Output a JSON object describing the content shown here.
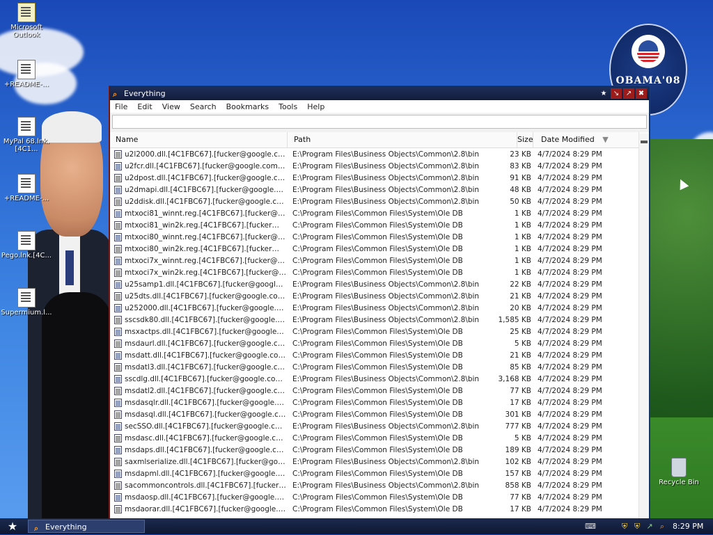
{
  "desktop": {
    "icons": [
      {
        "label": "Microsoft Outlook",
        "icon": "outlook-icon"
      },
      {
        "label": "+README-...",
        "icon": "document-icon"
      },
      {
        "label": "MyPal 68.lnk.[4C1...",
        "icon": "shortcut-icon"
      },
      {
        "label": "+README-...",
        "icon": "document-icon"
      },
      {
        "label": "Pego.lnk.[4C...",
        "icon": "shortcut-icon"
      },
      {
        "label": "Supermium.l...",
        "icon": "shortcut-icon"
      }
    ],
    "recycle_bin": "Recycle Bin",
    "wallpaper_badge": "OBAMA'08"
  },
  "window": {
    "title": "Everything",
    "menu": [
      "File",
      "Edit",
      "View",
      "Search",
      "Bookmarks",
      "Tools",
      "Help"
    ],
    "search": {
      "value": "",
      "placeholder": ""
    },
    "columns": {
      "name": "Name",
      "path": "Path",
      "size": "Size",
      "date": "Date Modified"
    },
    "rows": [
      {
        "name": "u2l2000.dll.[4C1FBC67].[fucker@google.com...",
        "path": "E:\\Program Files\\Business Objects\\Common\\2.8\\bin",
        "size": "23 KB",
        "date": "4/7/2024 8:29 PM"
      },
      {
        "name": "u2fcr.dll.[4C1FBC67].[fucker@google.com].f...",
        "path": "E:\\Program Files\\Business Objects\\Common\\2.8\\bin",
        "size": "83 KB",
        "date": "4/7/2024 8:29 PM"
      },
      {
        "name": "u2dpost.dll.[4C1FBC67].[fucker@google.com...",
        "path": "E:\\Program Files\\Business Objects\\Common\\2.8\\bin",
        "size": "91 KB",
        "date": "4/7/2024 8:29 PM"
      },
      {
        "name": "u2dmapi.dll.[4C1FBC67].[fucker@google.com...",
        "path": "E:\\Program Files\\Business Objects\\Common\\2.8\\bin",
        "size": "48 KB",
        "date": "4/7/2024 8:29 PM"
      },
      {
        "name": "u2ddisk.dll.[4C1FBC67].[fucker@google.com]...",
        "path": "E:\\Program Files\\Business Objects\\Common\\2.8\\bin",
        "size": "50 KB",
        "date": "4/7/2024 8:29 PM"
      },
      {
        "name": "mtxoci81_winnt.reg.[4C1FBC67].[fucker@go...",
        "path": "C:\\Program Files\\Common Files\\System\\Ole DB",
        "size": "1 KB",
        "date": "4/7/2024 8:29 PM"
      },
      {
        "name": "mtxoci81_win2k.reg.[4C1FBC67].[fucker@go...",
        "path": "C:\\Program Files\\Common Files\\System\\Ole DB",
        "size": "1 KB",
        "date": "4/7/2024 8:29 PM"
      },
      {
        "name": "mtxoci80_winnt.reg.[4C1FBC67].[fucker@go...",
        "path": "C:\\Program Files\\Common Files\\System\\Ole DB",
        "size": "1 KB",
        "date": "4/7/2024 8:29 PM"
      },
      {
        "name": "mtxoci80_win2k.reg.[4C1FBC67].[fucker@go...",
        "path": "C:\\Program Files\\Common Files\\System\\Ole DB",
        "size": "1 KB",
        "date": "4/7/2024 8:29 PM"
      },
      {
        "name": "mtxoci7x_winnt.reg.[4C1FBC67].[fucker@go...",
        "path": "C:\\Program Files\\Common Files\\System\\Ole DB",
        "size": "1 KB",
        "date": "4/7/2024 8:29 PM"
      },
      {
        "name": "mtxoci7x_win2k.reg.[4C1FBC67].[fucker@go...",
        "path": "C:\\Program Files\\Common Files\\System\\Ole DB",
        "size": "1 KB",
        "date": "4/7/2024 8:29 PM"
      },
      {
        "name": "u25samp1.dll.[4C1FBC67].[fucker@google.co...",
        "path": "E:\\Program Files\\Business Objects\\Common\\2.8\\bin",
        "size": "22 KB",
        "date": "4/7/2024 8:29 PM"
      },
      {
        "name": "u25dts.dll.[4C1FBC67].[fucker@google.com]....",
        "path": "E:\\Program Files\\Business Objects\\Common\\2.8\\bin",
        "size": "21 KB",
        "date": "4/7/2024 8:29 PM"
      },
      {
        "name": "u252000.dll.[4C1FBC67].[fucker@google.co...",
        "path": "E:\\Program Files\\Business Objects\\Common\\2.8\\bin",
        "size": "20 KB",
        "date": "4/7/2024 8:29 PM"
      },
      {
        "name": "sscsdk80.dll.[4C1FBC67].[fucker@google.co...",
        "path": "E:\\Program Files\\Business Objects\\Common\\2.8\\bin",
        "size": "1,585 KB",
        "date": "4/7/2024 8:29 PM"
      },
      {
        "name": "msxactps.dll.[4C1FBC67].[fucker@google.co...",
        "path": "C:\\Program Files\\Common Files\\System\\Ole DB",
        "size": "25 KB",
        "date": "4/7/2024 8:29 PM"
      },
      {
        "name": "msdaurl.dll.[4C1FBC67].[fucker@google.com]...",
        "path": "C:\\Program Files\\Common Files\\System\\Ole DB",
        "size": "5 KB",
        "date": "4/7/2024 8:29 PM"
      },
      {
        "name": "msdatt.dll.[4C1FBC67].[fucker@google.com]....",
        "path": "C:\\Program Files\\Common Files\\System\\Ole DB",
        "size": "21 KB",
        "date": "4/7/2024 8:29 PM"
      },
      {
        "name": "msdatl3.dll.[4C1FBC67].[fucker@google.com]...",
        "path": "C:\\Program Files\\Common Files\\System\\Ole DB",
        "size": "85 KB",
        "date": "4/7/2024 8:29 PM"
      },
      {
        "name": "sscdlg.dll.[4C1FBC67].[fucker@google.com].f...",
        "path": "E:\\Program Files\\Business Objects\\Common\\2.8\\bin",
        "size": "3,168 KB",
        "date": "4/7/2024 8:29 PM"
      },
      {
        "name": "msdatl2.dll.[4C1FBC67].[fucker@google.com]...",
        "path": "C:\\Program Files\\Common Files\\System\\Ole DB",
        "size": "77 KB",
        "date": "4/7/2024 8:29 PM"
      },
      {
        "name": "msdasqlr.dll.[4C1FBC67].[fucker@google.co...",
        "path": "C:\\Program Files\\Common Files\\System\\Ole DB",
        "size": "17 KB",
        "date": "4/7/2024 8:29 PM"
      },
      {
        "name": "msdasql.dll.[4C1FBC67].[fucker@google.com...",
        "path": "C:\\Program Files\\Common Files\\System\\Ole DB",
        "size": "301 KB",
        "date": "4/7/2024 8:29 PM"
      },
      {
        "name": "secSSO.dll.[4C1FBC67].[fucker@google.com]...",
        "path": "E:\\Program Files\\Business Objects\\Common\\2.8\\bin",
        "size": "777 KB",
        "date": "4/7/2024 8:29 PM"
      },
      {
        "name": "msdasc.dll.[4C1FBC67].[fucker@google.com]....",
        "path": "C:\\Program Files\\Common Files\\System\\Ole DB",
        "size": "5 KB",
        "date": "4/7/2024 8:29 PM"
      },
      {
        "name": "msdaps.dll.[4C1FBC67].[fucker@google.com]....",
        "path": "C:\\Program Files\\Common Files\\System\\Ole DB",
        "size": "189 KB",
        "date": "4/7/2024 8:29 PM"
      },
      {
        "name": "saxmlserialize.dll.[4C1FBC67].[fucker@googl...",
        "path": "E:\\Program Files\\Business Objects\\Common\\2.8\\bin",
        "size": "102 KB",
        "date": "4/7/2024 8:29 PM"
      },
      {
        "name": "msdapml.dll.[4C1FBC67].[fucker@google.com...",
        "path": "C:\\Program Files\\Common Files\\System\\Ole DB",
        "size": "157 KB",
        "date": "4/7/2024 8:29 PM"
      },
      {
        "name": "sacommoncontrols.dll.[4C1FBC67].[fucker@g...",
        "path": "E:\\Program Files\\Business Objects\\Common\\2.8\\bin",
        "size": "858 KB",
        "date": "4/7/2024 8:29 PM"
      },
      {
        "name": "msdaosp.dll.[4C1FBC67].[fucker@google.co...",
        "path": "C:\\Program Files\\Common Files\\System\\Ole DB",
        "size": "77 KB",
        "date": "4/7/2024 8:29 PM"
      },
      {
        "name": "msdaorar.dll.[4C1FBC67].[fucker@google.co...",
        "path": "C:\\Program Files\\Common Files\\System\\Ole DB",
        "size": "17 KB",
        "date": "4/7/2024 8:29 PM"
      }
    ]
  },
  "taskbar": {
    "task_label": "Everything",
    "clock": "8:29 PM"
  },
  "colors": {
    "titlebar": "#1f2f5a",
    "accent": "#ff9a1a"
  }
}
